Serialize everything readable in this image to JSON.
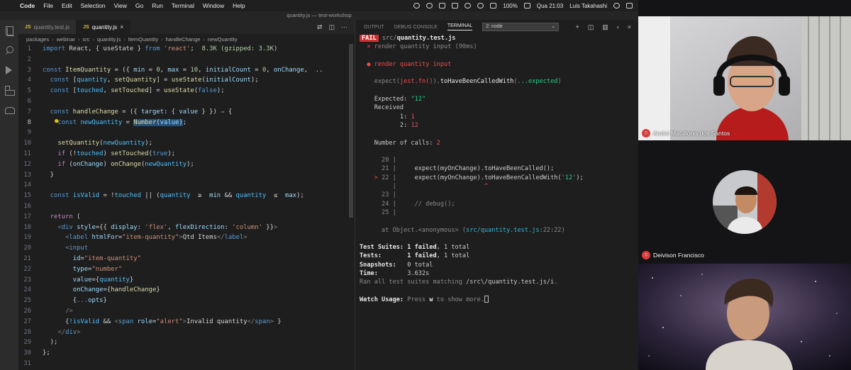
{
  "menubar": {
    "app": "Code",
    "items": [
      "File",
      "Edit",
      "Selection",
      "View",
      "Go",
      "Run",
      "Terminal",
      "Window",
      "Help"
    ],
    "battery": "100%",
    "clock": "Qua 21:03",
    "user": "Luis Takahashi"
  },
  "window_title": "quantity.js — test-workshop",
  "editor": {
    "tabs": [
      {
        "label": "quantity.test.js",
        "badge": "JS",
        "active": false
      },
      {
        "label": "quantity.js",
        "badge": "JS",
        "active": true
      }
    ],
    "breadcrumb": [
      "packages",
      "webinar",
      "src",
      "quantity.js",
      "ItemQuantity",
      "handleChange",
      "newQuantity"
    ],
    "current_line": "8"
  },
  "code_lines": [
    {
      "n": "1",
      "h": "<span class='kw'>import</span> React, { useState } <span class='kw'>from</span> <span class='str'>'react'</span>;  <span class='gz'>8.3K (gzipped: 3.3K)</span>"
    },
    {
      "n": "2",
      "h": ""
    },
    {
      "n": "3",
      "h": "<span class='kw'>const</span> <span class='fn'>ItemQuantity</span> = ({ <span class='vr'>min</span> = <span class='num'>0</span>, <span class='vr'>max</span> = <span class='num'>10</span>, <span class='vr'>initialCount</span> = <span class='num'>0</span>, <span class='vr'>onChange</span>,  .."
    },
    {
      "n": "4",
      "h": "  <span class='kw'>const</span> [<span class='cst'>quantity</span>, <span class='fn'>setQuantity</span>] = <span class='fn'>useState</span>(<span class='vr'>initialCount</span>);"
    },
    {
      "n": "5",
      "h": "  <span class='kw'>const</span> [<span class='cst'>touched</span>, <span class='fn'>setTouched</span>] = <span class='fn'>useState</span>(<span class='kw'>false</span>);"
    },
    {
      "n": "6",
      "h": ""
    },
    {
      "n": "7",
      "h": "  <span class='kw'>const</span> <span class='fn'>handleChange</span> = ({ <span class='vr'>target</span>: { <span class='vr'>value</span> } }) <span class='kw'>⇒</span> {"
    },
    {
      "n": "8",
      "h": "    <span class='kw'>const</span> <span class='cst'>newQuantity</span> = <span class='sel'><span class='fn'>Number</span>(<span class='vr'>value</span>)</span>;"
    },
    {
      "n": "9",
      "h": ""
    },
    {
      "n": "10",
      "h": "    <span class='fn'>setQuantity</span>(<span class='cst'>newQuantity</span>);"
    },
    {
      "n": "11",
      "h": "    <span class='ctl'>if</span> (!<span class='cst'>touched</span>) <span class='fn'>setTouched</span>(<span class='kw'>true</span>);"
    },
    {
      "n": "12",
      "h": "    <span class='ctl'>if</span> (<span class='vr'>onChange</span>) <span class='fn'>onChange</span>(<span class='cst'>newQuantity</span>);"
    },
    {
      "n": "13",
      "h": "  }"
    },
    {
      "n": "14",
      "h": ""
    },
    {
      "n": "15",
      "h": "  <span class='kw'>const</span> <span class='cst'>isValid</span> = !<span class='cst'>touched</span> || (<span class='cst'>quantity</span>  ≥  <span class='vr'>min</span> &amp;&amp; <span class='cst'>quantity</span>  ≤  <span class='vr'>max</span>);"
    },
    {
      "n": "16",
      "h": ""
    },
    {
      "n": "17",
      "h": "  <span class='ctl'>return</span> ("
    },
    {
      "n": "18",
      "h": "    <span class='pun'>&lt;</span><span class='tag'>div</span> <span class='attr'>style</span>={{ <span class='vr'>display</span>: <span class='str'>'flex'</span>, <span class='vr'>flexDirection</span>: <span class='str'>'column'</span> }}<span class='pun'>&gt;</span>"
    },
    {
      "n": "19",
      "h": "      <span class='pun'>&lt;</span><span class='tag'>label</span> <span class='attr'>htmlFor</span>=<span class='str'>\"item-quantity\"</span><span class='pun'>&gt;</span>Qtd Items<span class='pun'>&lt;/</span><span class='tag'>label</span><span class='pun'>&gt;</span>"
    },
    {
      "n": "20",
      "h": "      <span class='pun'>&lt;</span><span class='tag'>input</span>"
    },
    {
      "n": "21",
      "h": "        <span class='attr'>id</span>=<span class='str'>\"item-quantity\"</span>"
    },
    {
      "n": "22",
      "h": "        <span class='attr'>type</span>=<span class='str'>\"number\"</span>"
    },
    {
      "n": "23",
      "h": "        <span class='attr'>value</span>={<span class='cst'>quantity</span>}"
    },
    {
      "n": "24",
      "h": "        <span class='attr'>onChange</span>={<span class='fn'>handleChange</span>}"
    },
    {
      "n": "25",
      "h": "        {<span class='kw'>...</span><span class='vr'>opts</span>}"
    },
    {
      "n": "26",
      "h": "      <span class='pun'>/&gt;</span>"
    },
    {
      "n": "27",
      "h": "      {<span class='cst'>!isValid</span> &amp;&amp; <span class='pun'>&lt;</span><span class='tag'>span</span> <span class='attr'>role</span>=<span class='str'>\"alert\"</span><span class='pun'>&gt;</span>Invalid quantity<span class='pun'>&lt;/</span><span class='tag'>span</span><span class='pun'>&gt;</span> }"
    },
    {
      "n": "28",
      "h": "    <span class='pun'>&lt;/</span><span class='tag'>div</span><span class='pun'>&gt;</span>"
    },
    {
      "n": "29",
      "h": "  );"
    },
    {
      "n": "30",
      "h": "};"
    },
    {
      "n": "31",
      "h": ""
    }
  ],
  "terminal": {
    "tabs": [
      "OUTPUT",
      "DEBUG CONSOLE",
      "TERMINAL"
    ],
    "active_tab": "TERMINAL",
    "shell_select": "2: node",
    "lines": [
      {
        "h": "<span class='fail'>FAIL</span> <span class='dimw'>src/</span><span class='bold'>quantity.test.js</span>"
      },
      {
        "h": "  <span class='red'>×</span> <span class='grey'>render quantity input (90ms)</span>"
      },
      {
        "h": ""
      },
      {
        "h": "  <span class='red'>● render quantity input</span>"
      },
      {
        "h": ""
      },
      {
        "h": "    <span class='grey'>expect(</span><span class='red'>jest.fn()</span><span class='grey'>).</span><span class='white'>toHaveBeenCalledWith</span><span class='grey'>(</span><span class='green'>...expected</span><span class='grey'>)</span>"
      },
      {
        "h": ""
      },
      {
        "h": "    Expected: <span class='green'>\"12\"</span>"
      },
      {
        "h": "    Received"
      },
      {
        "h": "           1: <span class='red'>1</span>"
      },
      {
        "h": "           2: <span class='red'>12</span>"
      },
      {
        "h": ""
      },
      {
        "h": "    Number of calls: <span class='red'>2</span>"
      },
      {
        "h": ""
      },
      {
        "h": "      <span class='grey'>20 |</span>"
      },
      {
        "h": "      <span class='grey'>21 |</span>     expect(myOnChange).toHaveBeenCalled();"
      },
      {
        "h": "    <span class='red'>&gt;</span> <span class='grey'>22 |</span>     expect(myOnChange).toHaveBeenCalledWith(<span class='green'>'12'</span>);"
      },
      {
        "h": "         <span class='grey'>|</span>                        <span class='red'>^</span>"
      },
      {
        "h": "      <span class='grey'>23 |</span>"
      },
      {
        "h": "      <span class='grey'>24 |</span>     <span class='grey'>// debug();</span>"
      },
      {
        "h": "      <span class='grey'>25 |</span>"
      },
      {
        "h": ""
      },
      {
        "h": "      <span class='grey'>at Object.&lt;anonymous&gt; (</span><span class='cyan'>src/quantity.test.js</span><span class='grey'>:22:22)</span>"
      },
      {
        "h": ""
      },
      {
        "h": "<span class='bold'>Test Suites: </span><span class='red bold'>1 failed</span>, 1 total"
      },
      {
        "h": "<span class='bold'>Tests:       </span><span class='red bold'>1 failed</span>, 1 total"
      },
      {
        "h": "<span class='bold'>Snapshots:   </span>0 total"
      },
      {
        "h": "<span class='bold'>Time:        </span>3.632s"
      },
      {
        "h": "<span class='grey'>Ran all test suites matching </span>/src\\/quantity.test.js/i<span class='grey'>.</span>"
      },
      {
        "h": ""
      },
      {
        "h": "<span class='bold'>Watch Usage: </span><span class='grey'>Press </span><span class='bold'>w</span><span class='grey'> to show more.</span><span class='cursor'></span>"
      }
    ]
  },
  "participants": [
    {
      "name": "André Matulionis dos Santos",
      "muted": true
    },
    {
      "name": "Deivison Francisco",
      "muted": true
    },
    {
      "name": "",
      "muted": false
    }
  ],
  "colors": {
    "fail_red": "#cd3131",
    "selection": "#264f78",
    "mute_red": "#e23b3b"
  }
}
